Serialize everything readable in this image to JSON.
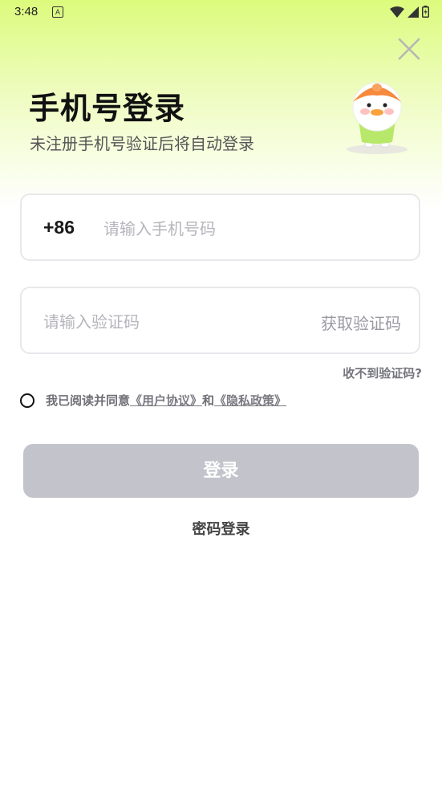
{
  "status_bar": {
    "time": "3:48",
    "notification": "A",
    "icons": [
      "wifi-icon",
      "cell-signal-icon",
      "battery-icon"
    ]
  },
  "header": {
    "close_icon": "close-icon",
    "title": "手机号登录",
    "subtitle": "未注册手机号验证后将自动登录",
    "mascot": "duck-mascot-illustration"
  },
  "phone_field": {
    "country_code": "+86",
    "placeholder": "请输入手机号码",
    "value": ""
  },
  "code_field": {
    "placeholder": "请输入验证码",
    "value": "",
    "get_code_label": "获取验证码"
  },
  "no_code_link": "收不到验证码?",
  "agreement": {
    "checked": false,
    "prefix": "我已阅读并同意",
    "user_agreement": "《用户协议》",
    "conjunction": "和",
    "privacy_policy": "《隐私政策》"
  },
  "login_button": "登录",
  "password_login": "密码登录",
  "colors": {
    "gradient_top": "#dcfb7c",
    "button_disabled": "#c3c4cb",
    "mascot_orange": "#f7893d",
    "mascot_green": "#b8e86a"
  }
}
